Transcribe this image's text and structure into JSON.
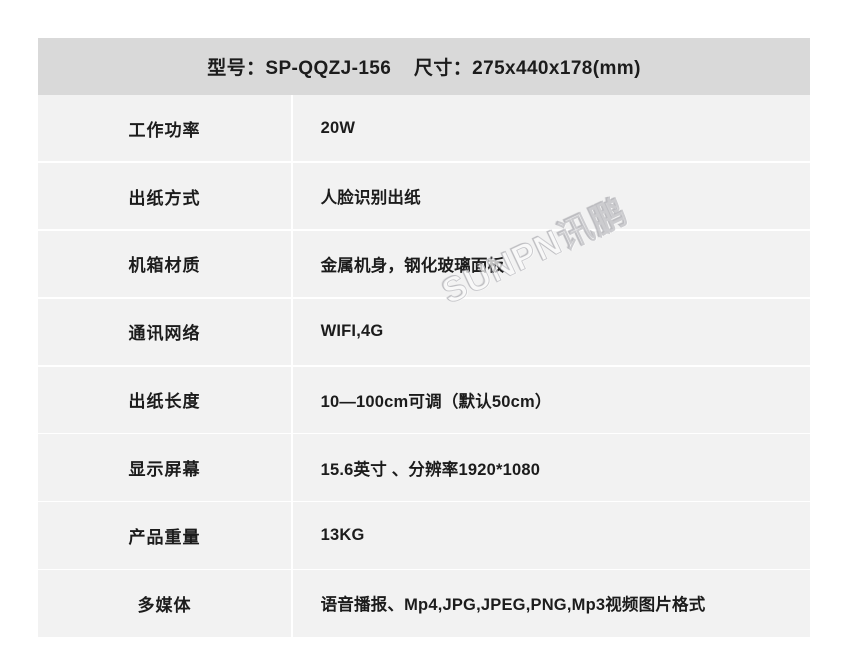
{
  "header": {
    "title": "型号：SP-QQZJ-156    尺寸：275x440x178(mm)",
    "model_label": "型号",
    "model_value": "SP-QQZJ-156",
    "size_label": "尺寸",
    "size_value": "275x440x178(mm)",
    "background_color": "#d9d9d9"
  },
  "watermark": {
    "text": "SUNPN讯鹏"
  },
  "table": {
    "row_background_color": "#f2f2f2",
    "text_color": "#1c1c1c",
    "rows": [
      {
        "label": "工作功率",
        "value": "20W"
      },
      {
        "label": "出纸方式",
        "value": "人脸识别出纸"
      },
      {
        "label": "机箱材质",
        "value": "金属机身，钢化玻璃面板"
      },
      {
        "label": "通讯网络",
        "value": "WIFI,4G"
      },
      {
        "label": "出纸长度",
        "value": "10—100cm可调（默认50cm）"
      },
      {
        "label": "显示屏幕",
        "value": "15.6英寸 、分辨率1920*1080"
      },
      {
        "label": "产品重量",
        "value": "13KG"
      },
      {
        "label": "多媒体",
        "value": "语音播报、Mp4,JPG,JPEG,PNG,Mp3视频图片格式"
      }
    ]
  }
}
